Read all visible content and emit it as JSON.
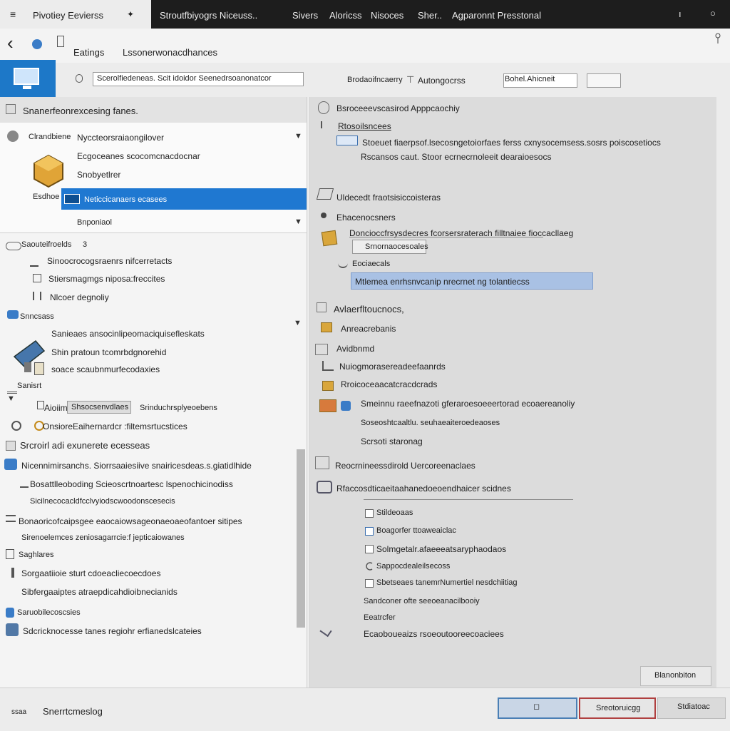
{
  "titlebar": {
    "menu_glyph": "≡",
    "active_tab": "Pivotiey Eevierss",
    "tab_pin": "✦",
    "tabs": [
      "Stroutfbiyogrs Niceuss..",
      "Sivers",
      "Aloricss",
      "Nisoces",
      "Sher..",
      "Agparonnt Presstonal"
    ],
    "controls": [
      "ı",
      "○"
    ]
  },
  "nav": {
    "back": "‹",
    "breadcrumb_small": "Eatings",
    "breadcrumb": "Lssonerwonacdhances"
  },
  "toolbar": {
    "search_value": "Scerolfiedeneas. Scit idoidor Seenedrsoanonatcor",
    "label_1": "Brodaoifncaerry",
    "label_2": "Autongocrss",
    "dropdown_value": "Bohel.Ahicneit",
    "button_label": ""
  },
  "left": {
    "header": "Snanerfeonrexcesing fanes.",
    "group": {
      "title_small": "Clrandbiene",
      "title": "Nyccteorsraiaongilover",
      "line_1": "Ecgoceanes scocomcnacdocnar",
      "line_2": "Snobyetlrer",
      "side_label": "Esdhoe",
      "selected": "Neticcicanaers ecasees",
      "footer": "Bnponiaol"
    },
    "list_a_title": "Saouteifroelds",
    "list_a_badge": "3",
    "list_a": [
      "Sinoocrocogsraenrs nifcerretacts",
      "Stiersmagmgs niposa:freccites",
      "Nlcoer degnoliy"
    ],
    "list_b_title": "Snncsass",
    "list_b": [
      "Sanieaes ansocinlipeomaciquisefleskats",
      "Shin pratoun tcomrbdgnorehid",
      "soace scaubnmurfecodaxies"
    ],
    "list_c_title": "Sanisrt",
    "list_c_item": "Aioiim",
    "list_c_field": "Shsocsenvdlaes",
    "list_c_right": "Srinduchrsplyeoebens",
    "list_d_label": "Onsiore",
    "list_d_value": "Eaihernardcr :filtemsrtucstices",
    "section_2": "Srcroirl adi exunerete ecesseas",
    "section_3": "Nicennimirsanchs. Siorrsaaiesiive snairicesdeas.s.giatidlhide",
    "section_3_items": [
      "Bosattlleoboding Scieoscrtnoartesc lspenochicinodiss",
      "Sicilnecocacldfcclvyiodscwoodonscesecis"
    ],
    "section_4": "Bonaoricofcaipsgee eaocaiowsageonaeoaeofantoer sitipes",
    "section_4_sub": "Sirenoelemces zeniosagarrcie:f jepticaiowanes",
    "section_5": "Saghlares",
    "section_5_items": [
      "Sorgaatiioie sturt cdoeacliecoecdoes",
      "Sibfergaaiptes atraepdicahdioibnecianids"
    ],
    "section_6": "Saruobilecoscsies",
    "section_6_sub": "Sdcricknocesse tanes regiohr erfianedslcateies"
  },
  "right": {
    "header": "Bsroceeevscasirod Apppcaochiy",
    "link": "Rtosoilsncees",
    "desc_1": "Stoeuet fiaerpsof.lsecosngetoiorfaes ferss cxnysocemsess.sosrs poiscosetiocs",
    "desc_2": "Rscansos caut. Stoor ecrnecrnoleeit dearaioesocs",
    "sec_a": "Uldecedt fraotsisiccoisteras",
    "sec_b": "Ehacenocsners",
    "sec_b_row": "Doncioccfrsysdecres fcorsersraterach filltnaiee fioccacllaeg",
    "sec_b_box": "Srnornaocesoales",
    "sec_c": "Eociaecals",
    "sec_c_selected": "Mtlemea enrhsnvcanip nrecrnet ng tolantiecss",
    "sec_d": "Avlaerfltoucnocs,",
    "sec_d_item": "Anreacrebanis",
    "sec_e": "Avidbnmd",
    "sec_e_items": [
      "Nuiogmorasereadeefaanrds",
      "Rroicoceaacatcracdcrads"
    ],
    "sec_e_long": "Smeinnu raeefnazoti gferaroesoeeertorad ecoaereanoliy",
    "sec_e_sub_1": "Soseoshtcaaltlu. seuhaeaiteroedeaoses",
    "sec_e_sub_2": "Scrsoti staronag",
    "sec_f": "Reocrnineessdirold Uercoreenaclaes",
    "sec_g": "Rfaccosdticaeitaahanedoeoendhaicer scidnes",
    "checks": [
      "Stildeoaas",
      "Boagorfer ttoaweaiclac",
      "Solmgetalr.afaeeeatsaryphaodaos",
      "Sappocdealeilsecoss",
      "Sbetseaes tanemrNumertiel nesdchiitiag"
    ],
    "note_1": "Sandconer ofte seeoeanacilbooiy",
    "note_2": "Eeatrcfer",
    "note_3": "Ecaoboueaizs rsoeoutooreecoaciees",
    "apply": "Blanonbiton"
  },
  "footer": {
    "left_small": "ssaa",
    "left": "Snerrtcmeslog",
    "ok": "◻",
    "cancel": "Sreotoruicgg",
    "help": "Stdiatoac"
  }
}
